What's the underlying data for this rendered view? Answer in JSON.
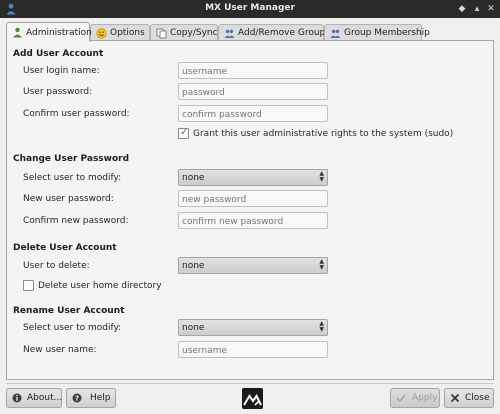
{
  "window": {
    "title": "MX User Manager"
  },
  "tabs": [
    {
      "label": "Administration",
      "icon": "user-icon",
      "active": true
    },
    {
      "label": "Options",
      "icon": "smiley-icon"
    },
    {
      "label": "Copy/Sync",
      "icon": "copy-icon"
    },
    {
      "label": "Add/Remove Groups",
      "icon": "group-icon"
    },
    {
      "label": "Group Membership",
      "icon": "group-membership-icon"
    }
  ],
  "add_user": {
    "heading": "Add User Account",
    "login_label": "User login name:",
    "login_placeholder": "username",
    "password_label": "User password:",
    "password_placeholder": "password",
    "confirm_label": "Confirm user password:",
    "confirm_placeholder": "confirm password",
    "sudo_label": "Grant this user administrative rights to the system (sudo)",
    "sudo_checked": true
  },
  "change_password": {
    "heading": "Change User Password",
    "select_label": "Select user to modify:",
    "select_value": "none",
    "new_label": "New user password:",
    "new_placeholder": "new password",
    "confirm_label": "Confirm new password:",
    "confirm_placeholder": "confirm new password"
  },
  "delete_user": {
    "heading": "Delete User Account",
    "select_label": "User to delete:",
    "select_value": "none",
    "home_label": "Delete user home directory",
    "home_checked": false
  },
  "rename_user": {
    "heading": "Rename User Account",
    "select_label": "Select user to modify:",
    "select_value": "none",
    "new_label": "New user name:",
    "new_placeholder": "username"
  },
  "footer": {
    "about_label": "About...",
    "help_label": "Help",
    "apply_label": "Apply",
    "close_label": "Close"
  },
  "colors": {
    "titlebar": "#2a2a2a",
    "accent": "#3b6fb0"
  }
}
